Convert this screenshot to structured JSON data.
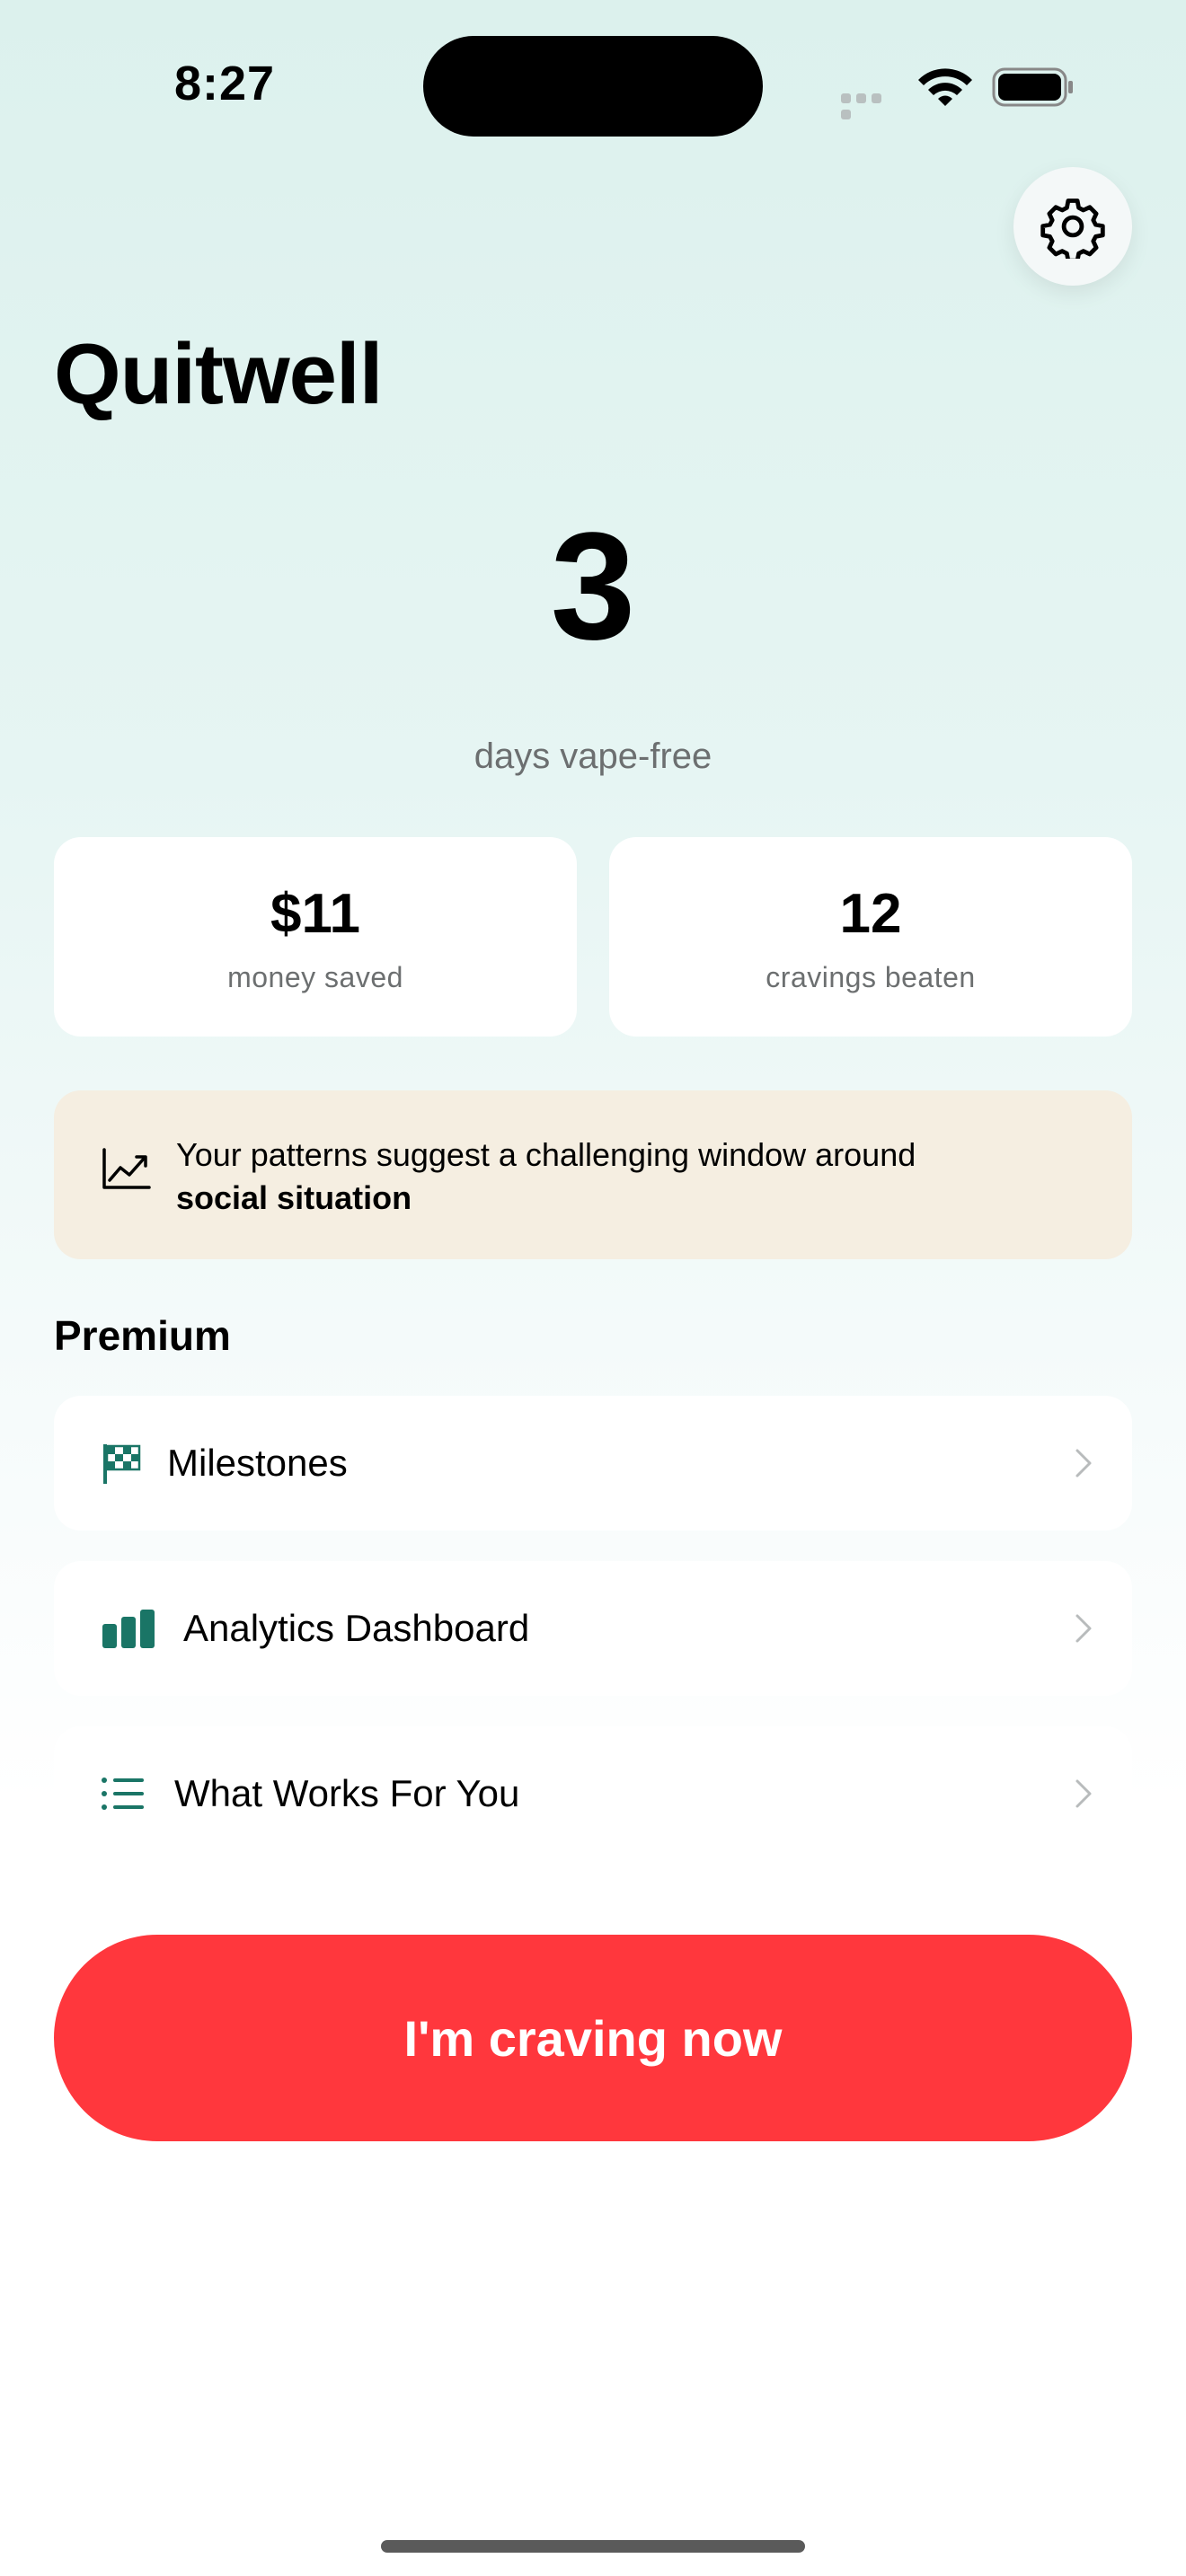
{
  "status_bar": {
    "time": "8:27"
  },
  "header": {
    "title": "Quitwell",
    "settings_icon": "gear-icon"
  },
  "streak": {
    "count": "3",
    "label": "days vape-free"
  },
  "stats": [
    {
      "value": "$11",
      "label": "money saved"
    },
    {
      "value": "12",
      "label": "cravings beaten"
    }
  ],
  "insight": {
    "icon": "trend-chart-icon",
    "text": "Your patterns suggest a challenging window around",
    "highlight": "social situation"
  },
  "premium": {
    "heading": "Premium",
    "items": [
      {
        "label": "Milestones",
        "icon": "checkered-flag-icon"
      },
      {
        "label": "Analytics Dashboard",
        "icon": "bar-chart-icon"
      },
      {
        "label": "What Works For You",
        "icon": "list-icon"
      }
    ]
  },
  "cta": {
    "label": "I'm craving now"
  },
  "colors": {
    "accent_red": "#ff373d",
    "teal": "#1a7566",
    "insight_bg": "#f5eee1"
  }
}
